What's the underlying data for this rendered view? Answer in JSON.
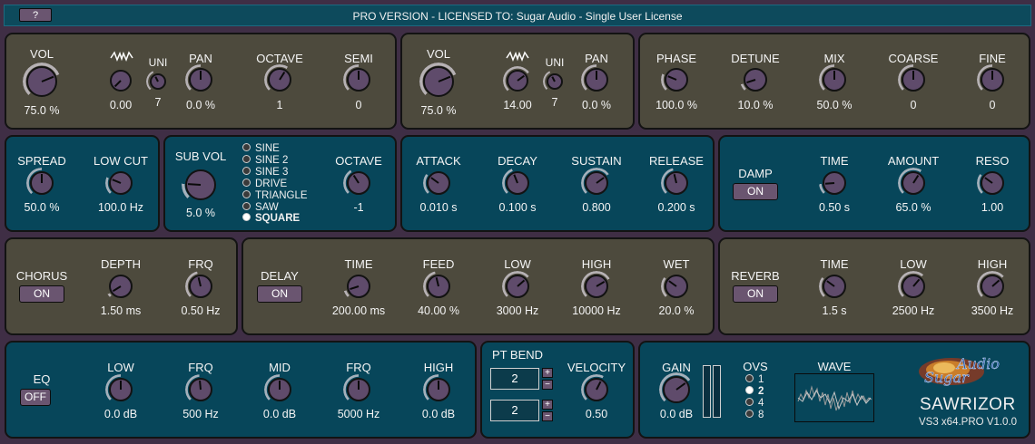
{
  "header": {
    "help_label": "?",
    "license_text": "PRO VERSION - LICENSED TO: Sugar Audio - Single User License"
  },
  "osc1": {
    "vol": {
      "label": "VOL",
      "value": "75.0 %"
    },
    "unison_voices": {
      "label": "UNI",
      "value": "7"
    },
    "unison_detune": {
      "value": "0.00"
    },
    "pan": {
      "label": "PAN",
      "value": "0.0 %"
    },
    "octave": {
      "label": "OCTAVE",
      "value": "1"
    },
    "semi": {
      "label": "SEMI",
      "value": "0"
    }
  },
  "osc2": {
    "vol": {
      "label": "VOL",
      "value": "75.0 %"
    },
    "unison_voices": {
      "label": "UNI",
      "value": "7"
    },
    "unison_detune": {
      "value": "14.00"
    },
    "pan": {
      "label": "PAN",
      "value": "0.0 %"
    }
  },
  "mixer": {
    "phase": {
      "label": "PHASE",
      "value": "100.0 %"
    },
    "detune": {
      "label": "DETUNE",
      "value": "10.0 %"
    },
    "mix": {
      "label": "MIX",
      "value": "50.0 %"
    },
    "coarse": {
      "label": "COARSE",
      "value": "0"
    },
    "fine": {
      "label": "FINE",
      "value": "0"
    }
  },
  "spread": {
    "spread": {
      "label": "SPREAD",
      "value": "50.0 %"
    },
    "low_cut": {
      "label": "LOW CUT",
      "value": "100.0 Hz"
    }
  },
  "sub": {
    "vol": {
      "label": "SUB VOL",
      "value": "5.0 %"
    },
    "waveforms": [
      "SINE",
      "SINE 2",
      "SINE 3",
      "DRIVE",
      "TRIANGLE",
      "SAW",
      "SQUARE"
    ],
    "selected_waveform": "SQUARE",
    "octave": {
      "label": "OCTAVE",
      "value": "-1"
    }
  },
  "envelope": {
    "attack": {
      "label": "ATTACK",
      "value": "0.010 s"
    },
    "decay": {
      "label": "DECAY",
      "value": "0.100 s"
    },
    "sustain": {
      "label": "SUSTAIN",
      "value": "0.800"
    },
    "release": {
      "label": "RELEASE",
      "value": "0.200 s"
    }
  },
  "damp": {
    "label": "DAMP",
    "toggle": "ON",
    "time": {
      "label": "TIME",
      "value": "0.50 s"
    },
    "amount": {
      "label": "AMOUNT",
      "value": "65.0 %"
    },
    "reso": {
      "label": "RESO",
      "value": "1.00"
    }
  },
  "chorus": {
    "label": "CHORUS",
    "toggle": "ON",
    "depth": {
      "label": "DEPTH",
      "value": "1.50 ms"
    },
    "frq": {
      "label": "FRQ",
      "value": "0.50 Hz"
    }
  },
  "delay": {
    "label": "DELAY",
    "toggle": "ON",
    "time": {
      "label": "TIME",
      "value": "200.00 ms"
    },
    "feed": {
      "label": "FEED",
      "value": "40.00 %"
    },
    "low": {
      "label": "LOW",
      "value": "3000 Hz"
    },
    "high": {
      "label": "HIGH",
      "value": "10000 Hz"
    },
    "wet": {
      "label": "WET",
      "value": "20.0 %"
    }
  },
  "reverb": {
    "label": "REVERB",
    "toggle": "ON",
    "time": {
      "label": "TIME",
      "value": "1.5 s"
    },
    "low": {
      "label": "LOW",
      "value": "2500 Hz"
    },
    "high": {
      "label": "HIGH",
      "value": "3500 Hz"
    }
  },
  "eq": {
    "label": "EQ",
    "toggle": "OFF",
    "low": {
      "label": "LOW",
      "value": "0.0 dB"
    },
    "frq1": {
      "label": "FRQ",
      "value": "500 Hz"
    },
    "mid": {
      "label": "MID",
      "value": "0.0 dB"
    },
    "frq2": {
      "label": "FRQ",
      "value": "5000 Hz"
    },
    "high": {
      "label": "HIGH",
      "value": "0.0 dB"
    }
  },
  "pitch": {
    "pt_bend": {
      "label": "PT BEND",
      "up_value": "2",
      "down_value": "2",
      "plus": "+",
      "minus": "−"
    },
    "velocity": {
      "label": "VELOCITY",
      "value": "0.50"
    }
  },
  "output": {
    "gain": {
      "label": "GAIN",
      "value": "0.0 dB"
    },
    "ovs": {
      "label": "OVS",
      "options": [
        "1",
        "2",
        "4",
        "8"
      ],
      "selected": "2"
    },
    "wave": {
      "label": "WAVE"
    }
  },
  "brand": {
    "logo_text": "Audio Sugar",
    "product": "SAWRIZOR",
    "version": "VS3 x64.PRO V1.0.0"
  },
  "colors": {
    "olive_panel": "#4d4a3d",
    "teal_panel": "#07465a",
    "knob_body": "#5f4b6b",
    "arc_highlight": "#d9d4dc",
    "background": "#3f2e45"
  },
  "knob_levels": {
    "osc1_vol": 0.75,
    "osc1_detune": 0.0,
    "osc1_uni": 0.4,
    "osc1_pan": 0.5,
    "osc1_octave": 0.62,
    "osc1_semi": 0.5,
    "osc2_vol": 0.75,
    "osc2_detune": 0.7,
    "osc2_uni": 0.4,
    "osc2_pan": 0.5,
    "phase": 0.25,
    "detune": 0.1,
    "mix": 0.5,
    "coarse": 0.5,
    "fine": 0.5,
    "spread": 0.5,
    "low_cut": 0.25,
    "sub_vol": 0.18,
    "sub_octave": 0.38,
    "attack": 0.3,
    "decay": 0.42,
    "sustain": 0.7,
    "release": 0.45,
    "damp_time": 0.15,
    "amount": 0.62,
    "reso": 0.3,
    "depth": 0.05,
    "chorus_frq": 0.45,
    "delay_time": 0.1,
    "feed": 0.45,
    "delay_low": 0.68,
    "delay_high": 0.72,
    "wet": 0.3,
    "rev_time": 0.3,
    "rev_low": 0.65,
    "rev_high": 0.68,
    "eq_low": 0.5,
    "eq_frq1": 0.48,
    "eq_mid": 0.5,
    "eq_frq2": 0.5,
    "eq_high": 0.5,
    "velocity": 0.6,
    "gain": 0.7
  }
}
